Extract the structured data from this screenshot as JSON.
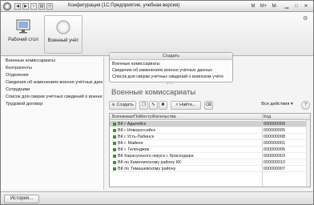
{
  "titlebar": {
    "title": "Конфигурация  (1С:Предприятие, учебная версия)",
    "right_buttons": [
      "M",
      "M+",
      "M-"
    ]
  },
  "sections": [
    {
      "label": "Рабочий стол"
    },
    {
      "label": "Военный учёт"
    }
  ],
  "sidebar": {
    "items": [
      {
        "label": "Военные комиссариаты"
      },
      {
        "label": "Контрагенты"
      },
      {
        "label": "Отделения"
      },
      {
        "label": "Сведения об изменениях военно учётных данных"
      },
      {
        "label": "Сотрудники"
      },
      {
        "label": "Список для сверки учётных сведений о военном учёте"
      },
      {
        "label": "Трудовой договор"
      }
    ]
  },
  "create_panel": {
    "title": "Создать",
    "items": [
      {
        "label": "Военные комиссариаты"
      },
      {
        "label": "Сведения об изменениях военно учётных данных"
      },
      {
        "label": "Список для сверки учётных сведений о воинском учёте"
      }
    ]
  },
  "form": {
    "title": "Военные комиссариаты",
    "toolbar": {
      "create_label": "Создать",
      "find_label": "Найти...",
      "all_actions_label": "Все действия"
    },
    "columns": [
      "ВоенкоматПоМестуЖительства",
      "Код"
    ],
    "rows": [
      {
        "name": "ВК г Адыгейск",
        "code": "000000009",
        "selected": true
      },
      {
        "name": "ВК г Новороссийск",
        "code": "000000005",
        "selected": false
      },
      {
        "name": "ВК г Усть-Лабинск",
        "code": "000000008",
        "selected": false
      },
      {
        "name": "ВК г. Майкоп",
        "code": "000000001",
        "selected": false
      },
      {
        "name": "ВК г. Геленджик",
        "code": "000000006",
        "selected": false
      },
      {
        "name": "ВК Карасунского округа г. Краснодара",
        "code": "000000003",
        "selected": false
      },
      {
        "name": "ВК по Каменинскому району КК",
        "code": "000000010",
        "selected": false
      },
      {
        "name": "ВК по Тимашевскому району",
        "code": "000000007",
        "selected": false
      }
    ]
  },
  "bottom": {
    "history_label": "История..."
  },
  "colors": {
    "selected_row": "#cfcfcf",
    "row_icon": "#2f9a2f",
    "title_text": "#555555"
  }
}
